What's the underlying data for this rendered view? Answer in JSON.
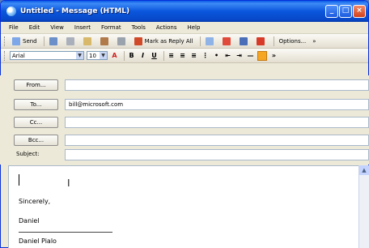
{
  "window": {
    "title": "Untitled - Message (HTML)"
  },
  "menu": [
    "File",
    "Edit",
    "View",
    "Insert",
    "Format",
    "Tools",
    "Actions",
    "Help"
  ],
  "toolbar": {
    "send_label": "Send",
    "reply_label": "Mark as Reply All",
    "options_label": "Options..."
  },
  "format": {
    "font": "Arial",
    "size": "10",
    "bold": "B",
    "italic": "I",
    "underline": "U"
  },
  "header": {
    "from_label": "From...",
    "to_label": "To...",
    "to_value": "bill@microsoft.com",
    "cc_label": "Cc...",
    "bcc_label": "Bcc...",
    "subject_label": "Subject:",
    "subject_value": ""
  },
  "body": {
    "signoff": "Sincerely,",
    "name": "Daniel",
    "fullname": "Daniel Pialo"
  },
  "colors": {
    "titlebar": "#0a56dc",
    "accent": "#f5a623"
  }
}
